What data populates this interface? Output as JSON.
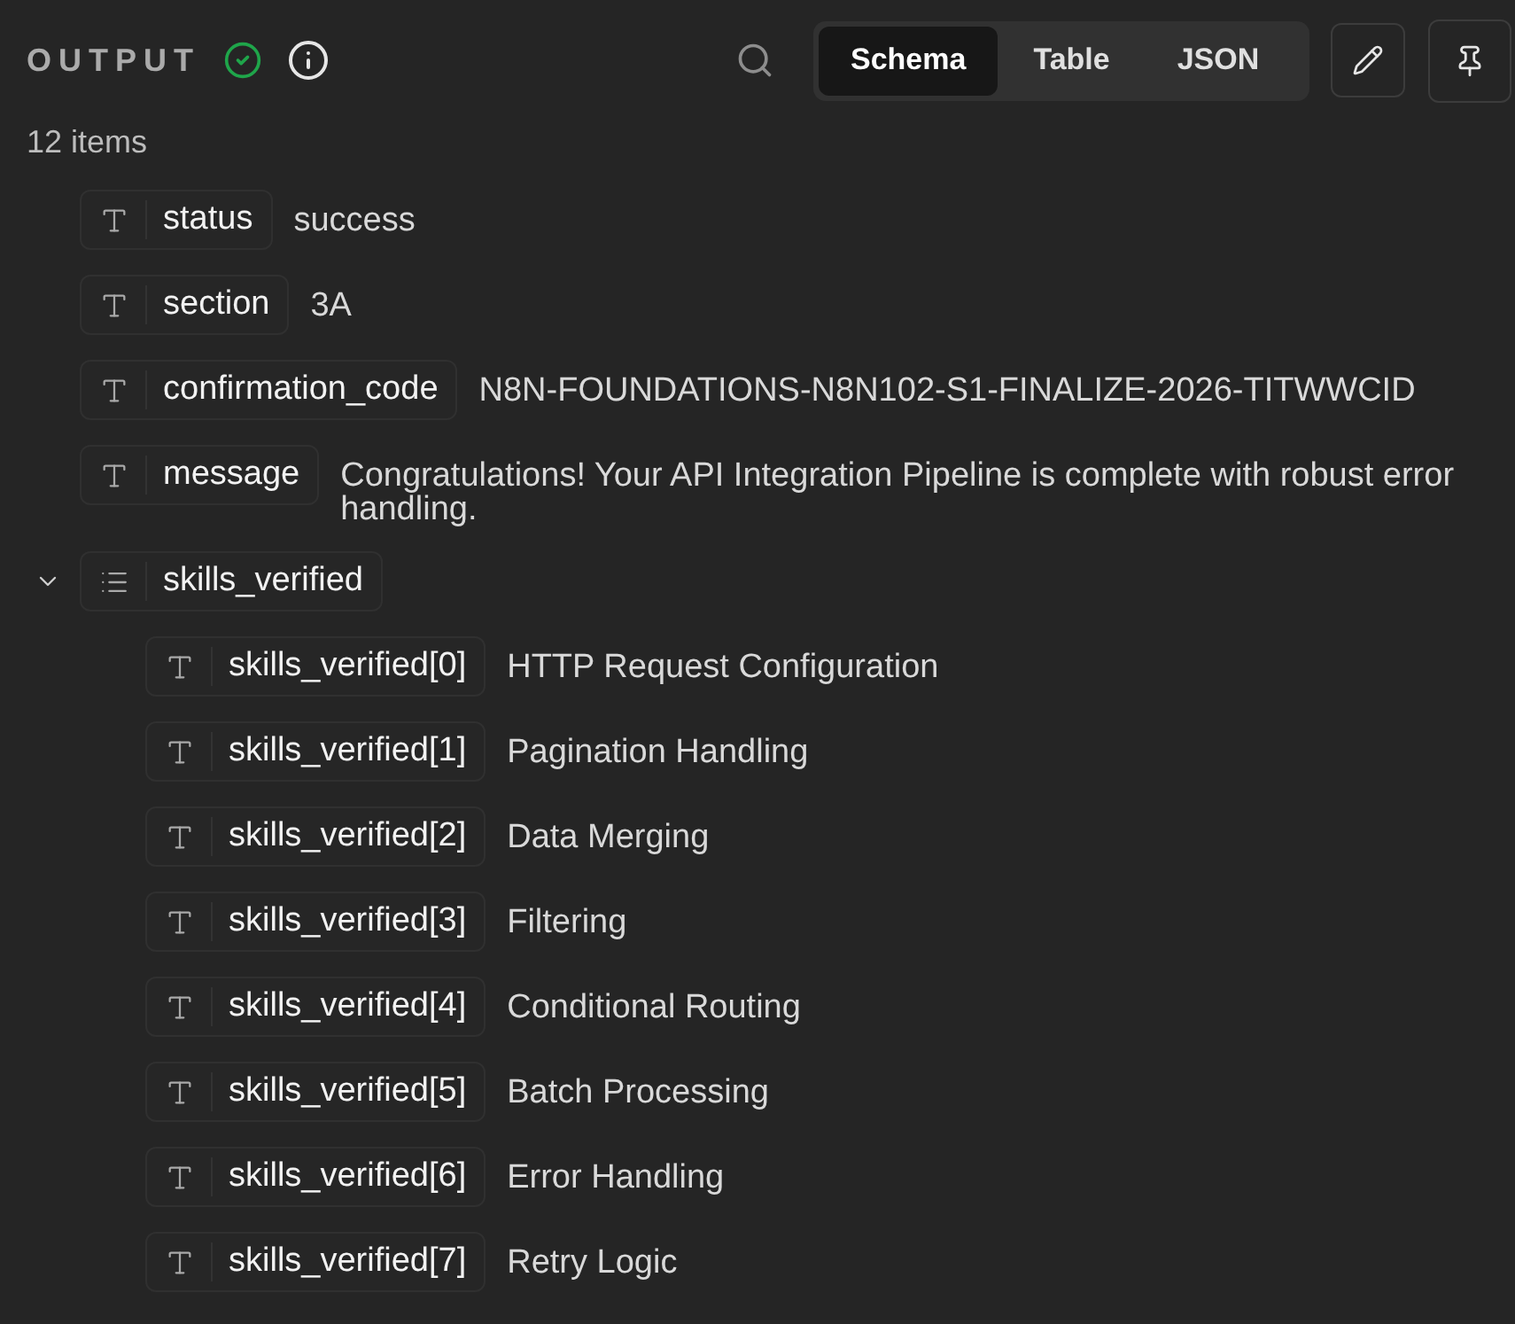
{
  "header": {
    "title": "OUTPUT",
    "tabs": [
      {
        "label": "Schema",
        "selected": true
      },
      {
        "label": "Table",
        "selected": false
      },
      {
        "label": "JSON",
        "selected": false
      }
    ]
  },
  "item_count": "12 items",
  "fields": [
    {
      "kind": "text",
      "key": "status",
      "value": "success"
    },
    {
      "kind": "text",
      "key": "section",
      "value": "3A"
    },
    {
      "kind": "text",
      "key": "confirmation_code",
      "value": "N8N-FOUNDATIONS-N8N102-S1-FINALIZE-2026-TITWWCID"
    },
    {
      "kind": "text",
      "key": "message",
      "value": "Congratulations! Your API Integration Pipeline is complete with robust error handling."
    },
    {
      "kind": "array",
      "key": "skills_verified",
      "expanded": true,
      "children": [
        {
          "kind": "text",
          "key": "skills_verified[0]",
          "value": "HTTP Request Configuration"
        },
        {
          "kind": "text",
          "key": "skills_verified[1]",
          "value": "Pagination Handling"
        },
        {
          "kind": "text",
          "key": "skills_verified[2]",
          "value": "Data Merging"
        },
        {
          "kind": "text",
          "key": "skills_verified[3]",
          "value": "Filtering"
        },
        {
          "kind": "text",
          "key": "skills_verified[4]",
          "value": "Conditional Routing"
        },
        {
          "kind": "text",
          "key": "skills_verified[5]",
          "value": "Batch Processing"
        },
        {
          "kind": "text",
          "key": "skills_verified[6]",
          "value": "Error Handling"
        },
        {
          "kind": "text",
          "key": "skills_verified[7]",
          "value": "Retry Logic"
        }
      ]
    }
  ]
}
